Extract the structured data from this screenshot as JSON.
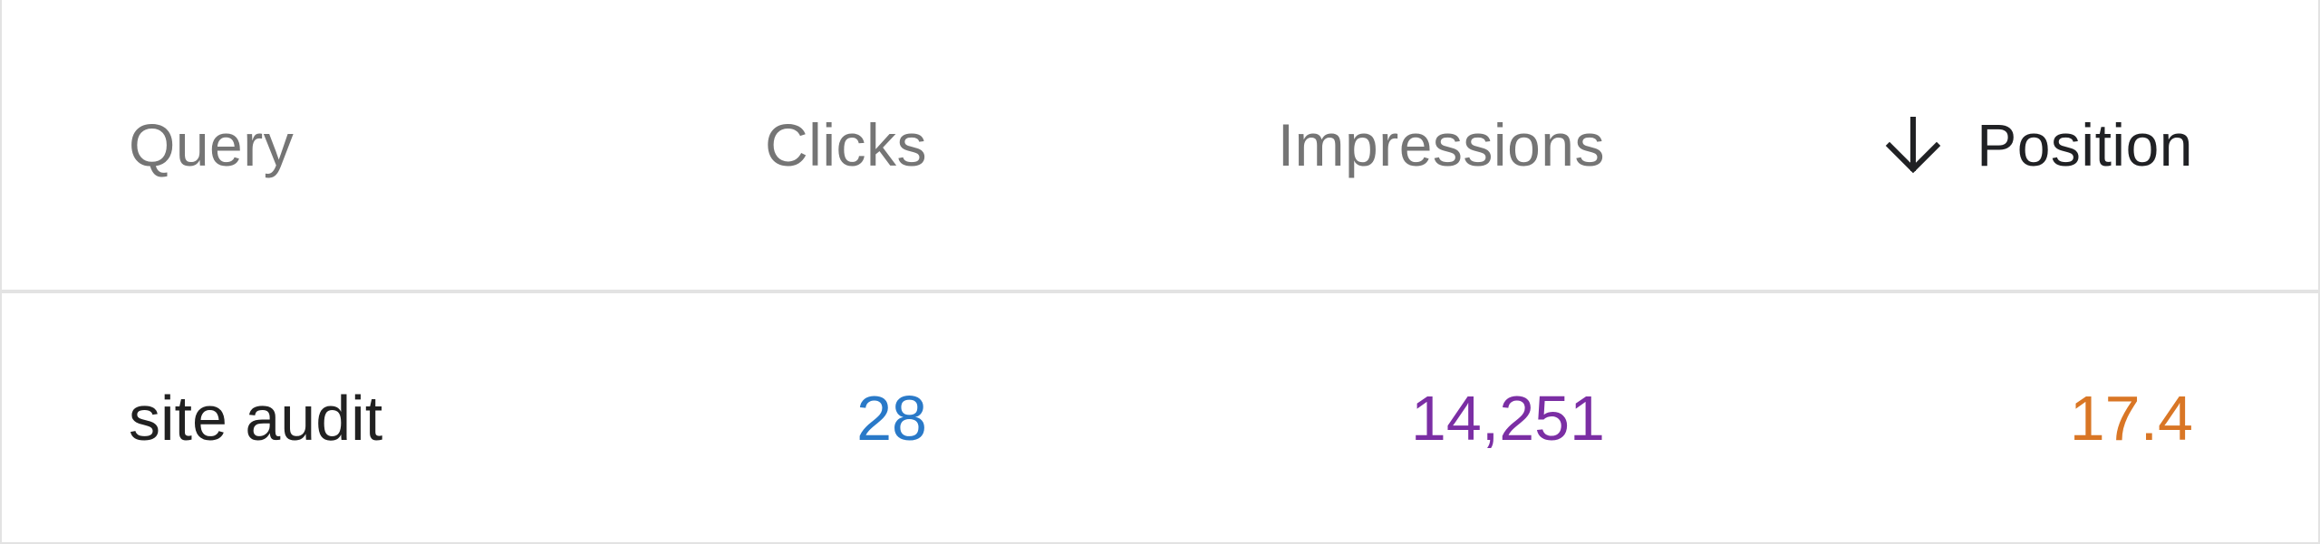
{
  "table": {
    "columns": [
      {
        "key": "query",
        "label": "Query",
        "sorted": false
      },
      {
        "key": "clicks",
        "label": "Clicks",
        "sorted": false
      },
      {
        "key": "impressions",
        "label": "Impressions",
        "sorted": false
      },
      {
        "key": "position",
        "label": "Position",
        "sorted": true,
        "sort_direction": "descending",
        "sort_icon": "arrow-down-icon"
      }
    ],
    "rows": [
      {
        "query": "site audit",
        "clicks": "28",
        "impressions": "14,251",
        "position": "17.4"
      }
    ]
  },
  "colors": {
    "clicks": "#2979c8",
    "impressions": "#7b2ea4",
    "position": "#d97625",
    "header_inactive": "#757575",
    "header_active": "#202124",
    "divider": "#e3e3e3"
  }
}
